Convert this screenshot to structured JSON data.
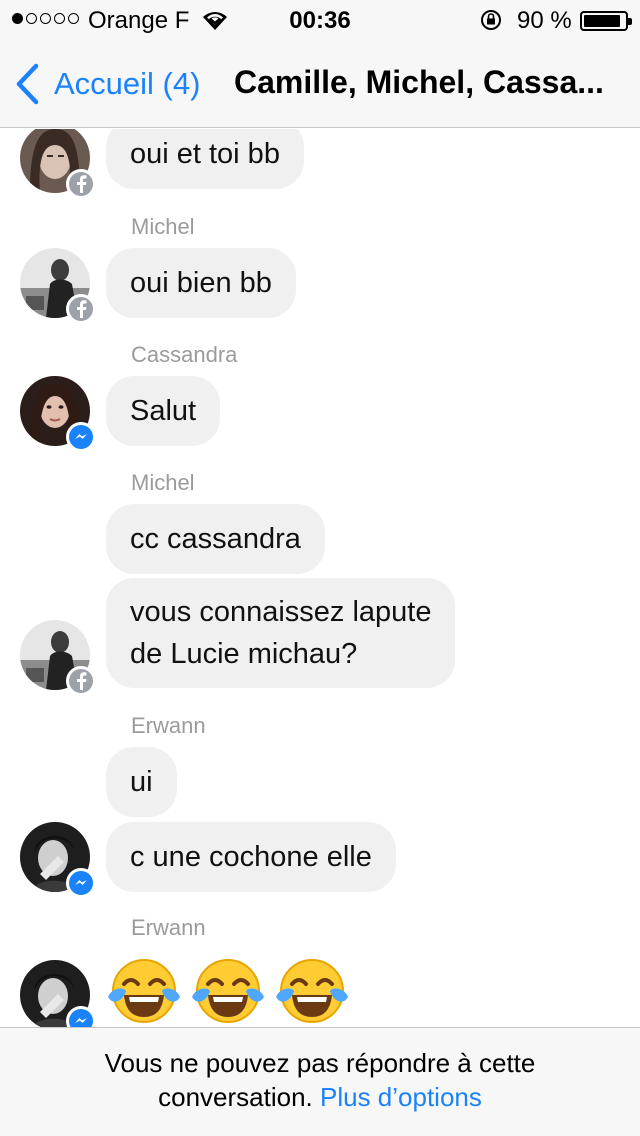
{
  "status_bar": {
    "carrier": "Orange F",
    "time": "00:36",
    "battery": "90 %",
    "battery_level": 0.9,
    "signal_bars_filled": 1
  },
  "nav": {
    "back_label": "Accueil (4)",
    "title": "Camille, Michel, Cassa..."
  },
  "messages": [
    {
      "sender": "",
      "text": "oui et toi bb",
      "source": "facebook"
    },
    {
      "sender": "Michel",
      "text": "oui bien bb",
      "source": "facebook"
    },
    {
      "sender": "Cassandra",
      "text": "Salut",
      "source": "messenger"
    },
    {
      "sender": "Michel",
      "text": "cc cassandra",
      "source": "facebook"
    },
    {
      "sender": "",
      "line1": "vous connaissez lapute",
      "line2": "de Lucie michau?",
      "source": "facebook"
    },
    {
      "sender": "Erwann",
      "text": "ui",
      "source": "messenger"
    },
    {
      "sender": "",
      "text": "c une cochone elle",
      "source": "messenger"
    },
    {
      "sender": "Erwann",
      "emoji": "face-with-tears-of-joy",
      "count": 3,
      "source": "messenger"
    }
  ],
  "footer": {
    "line1": "Vous ne pouvez pas répondre à cette",
    "line2_prefix": "conversation.",
    "link": "Plus d’options"
  },
  "colors": {
    "accent": "#1a82fb",
    "bubble": "#f1f0f0",
    "sender_name": "#9b9b9b",
    "bars": "#f7f7f7",
    "fb_badge": "#9da1a8"
  }
}
